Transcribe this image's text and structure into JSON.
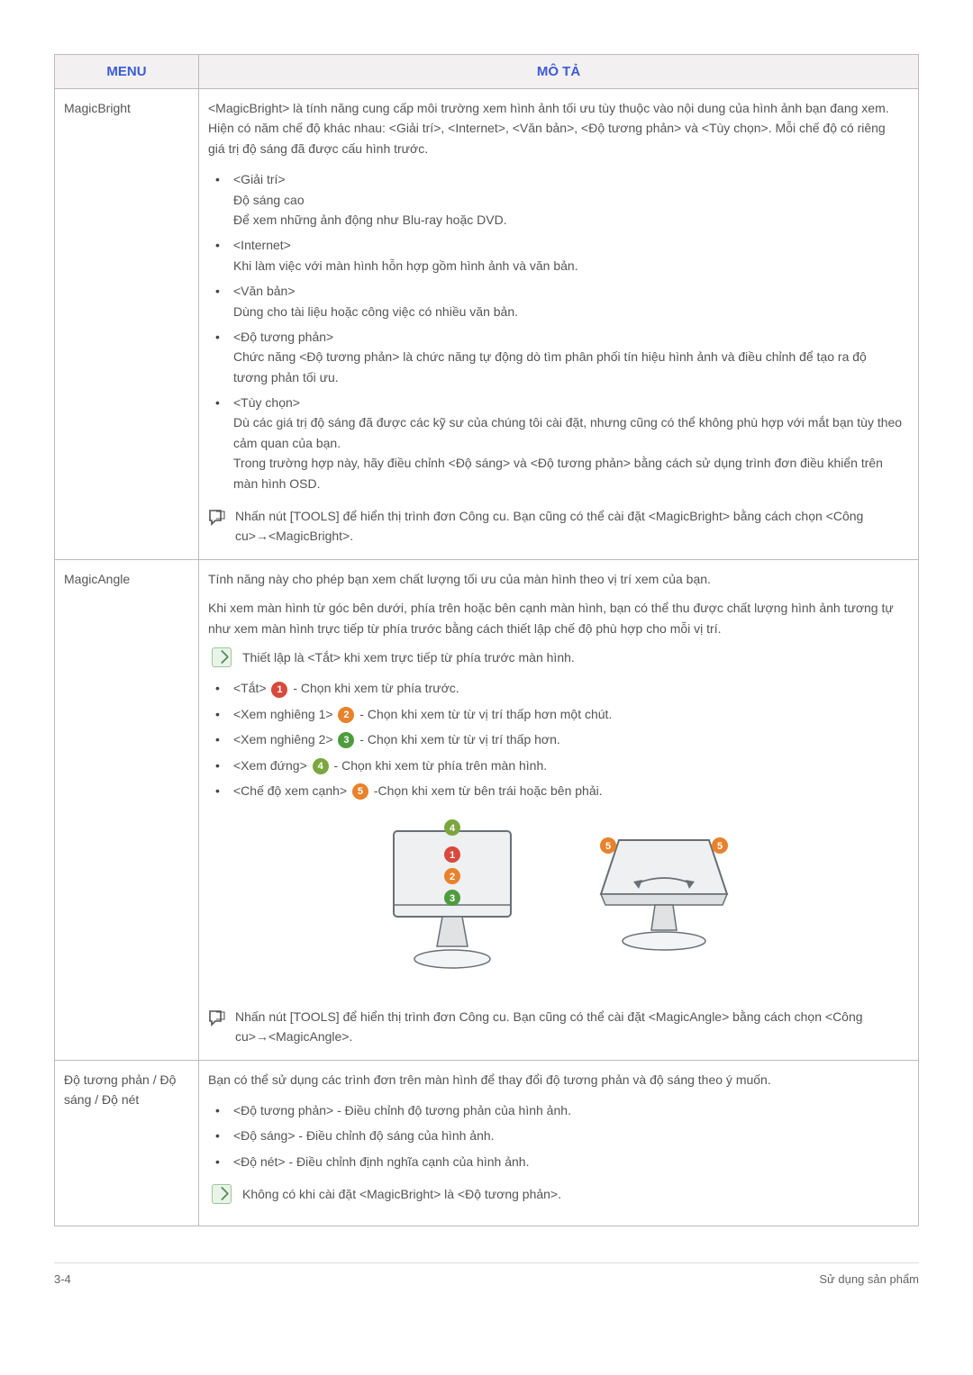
{
  "header": {
    "menu": "MENU",
    "desc": "MÔ TẢ"
  },
  "rows": [
    {
      "label": "MagicBright",
      "intro": "<MagicBright> là tính năng cung cấp môi trường xem hình ảnh tối ưu tùy thuộc vào nội dung của hình ảnh bạn đang xem. Hiện có năm chế độ khác nhau: <Giải trí>, <Internet>, <Văn bản>, <Độ tương phản> và <Tùy chọn>. Mỗi chế độ có riêng giá trị độ sáng đã được cấu hình trước.",
      "items": [
        {
          "title": "<Giải trí>",
          "lines": [
            "Độ sáng cao",
            "Để xem những ảnh động như Blu-ray hoặc DVD."
          ]
        },
        {
          "title": "<Internet>",
          "lines": [
            "Khi làm việc với màn hình hỗn hợp gồm hình ảnh và văn bản."
          ]
        },
        {
          "title": "<Văn bản>",
          "lines": [
            "Dùng cho tài liệu hoặc công việc có nhiều văn bản."
          ]
        },
        {
          "title": "<Độ tương phản>",
          "lines": [
            "Chức năng <Độ tương phản> là chức năng tự động dò tìm phân phối tín hiệu hình ảnh và điều chỉnh để tạo ra độ tương phản tối ưu."
          ]
        },
        {
          "title": "<Tùy chọn>",
          "lines": [
            "Dù các giá trị độ sáng đã được các kỹ sư của chúng tôi cài đặt, nhưng cũng có thể không phù hợp với mắt bạn tùy theo cảm quan của bạn.",
            "Trong trường hợp này, hãy điều chỉnh <Độ sáng> và <Độ tương phản> bằng cách sử dụng trình đơn điều khiển trên màn hình OSD."
          ]
        }
      ],
      "note": "Nhấn nút [TOOLS] để hiển thị trình đơn Công cu. Bạn cũng có thể cài đặt <MagicBright> bằng cách chọn <Công cu>→<MagicBright>."
    },
    {
      "label": "MagicAngle",
      "p1": "Tính năng này cho phép bạn xem chất lượng tối ưu của màn hình theo vị trí xem của bạn.",
      "p2": "Khi xem màn hình từ góc bên dưới, phía trên hoặc bên cạnh màn hình, bạn có thể thu được chất lượng hình ảnh tương tự như xem màn hình trực tiếp từ phía trước bằng cách thiết lập chế độ phù hợp cho mỗi vị trí.",
      "tip": "Thiết lập là <Tắt> khi xem trực tiếp từ phía trước màn hình.",
      "modes": [
        {
          "pre": "<Tắt> ",
          "num": "1",
          "color": "c1",
          "post": " - Chọn khi xem từ phía trước."
        },
        {
          "pre": "<Xem nghiêng 1> ",
          "num": "2",
          "color": "c2",
          "post": " - Chọn khi xem từ từ vị trí thấp hơn một chút."
        },
        {
          "pre": "<Xem nghiêng 2> ",
          "num": "3",
          "color": "c3",
          "post": " - Chọn khi xem từ từ vị trí thấp hơn."
        },
        {
          "pre": "<Xem đứng> ",
          "num": "4",
          "color": "c4",
          "post": " - Chọn khi xem từ phía trên màn hình."
        },
        {
          "pre": "<Chế độ xem cạnh> ",
          "num": "5",
          "color": "c5",
          "post": " -Chọn khi xem từ bên trái hoặc bên phải."
        }
      ],
      "note": "Nhấn nút [TOOLS] để hiển thị trình đơn Công cu. Bạn cũng có thể cài đặt <MagicAngle> bằng cách chọn <Công cu>→<MagicAngle>."
    },
    {
      "label": "Độ tương phản / Độ sáng / Độ nét",
      "intro": "Bạn có thể sử dụng các trình đơn trên màn hình để thay đổi độ tương phản và độ sáng theo ý muốn.",
      "items2": [
        "<Độ tương phản> - Điều chỉnh độ tương phản của hình ảnh.",
        "<Độ sáng> - Điều chỉnh độ sáng của hình ảnh.",
        "<Độ nét> - Điều chỉnh định nghĩa cạnh của hình ảnh."
      ],
      "tip": "Không có khi cài đặt <MagicBright> là <Độ tương phản>."
    }
  ],
  "footer": {
    "left": "3-4",
    "right": "Sử dụng sản phẩm"
  },
  "diagram": {
    "labels": {
      "n1": "1",
      "n2": "2",
      "n3": "3",
      "n4": "4",
      "n5a": "5",
      "n5b": "5"
    }
  }
}
